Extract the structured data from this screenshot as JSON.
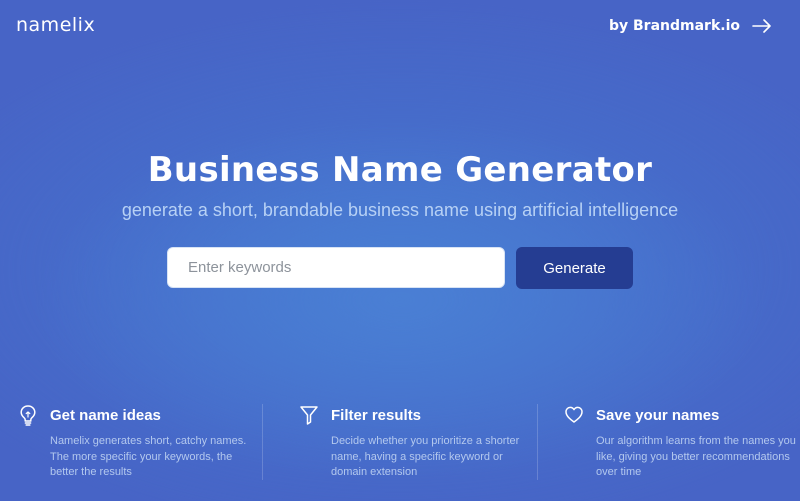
{
  "header": {
    "logo": "namelix",
    "by_link": "by Brandmark.io",
    "by_link_icon": "arrow-right-icon"
  },
  "hero": {
    "title": "Business Name Generator",
    "subtitle": "generate a short, brandable business name using artificial intelligence"
  },
  "search": {
    "placeholder": "Enter keywords",
    "value": "",
    "button_label": "Generate"
  },
  "features": [
    {
      "icon": "lightbulb-icon",
      "title": "Get name ideas",
      "description": "Namelix generates short, catchy names. The more specific your keywords, the better the results"
    },
    {
      "icon": "filter-icon",
      "title": "Filter results",
      "description": "Decide whether you prioritize a shorter name, having a specific keyword or domain extension"
    },
    {
      "icon": "heart-icon",
      "title": "Save your names",
      "description": "Our algorithm learns from the names you like, giving you better recommendations over time"
    }
  ],
  "colors": {
    "background": "#4764c6",
    "button": "#253d92",
    "subtitle": "#b7d1f5"
  }
}
